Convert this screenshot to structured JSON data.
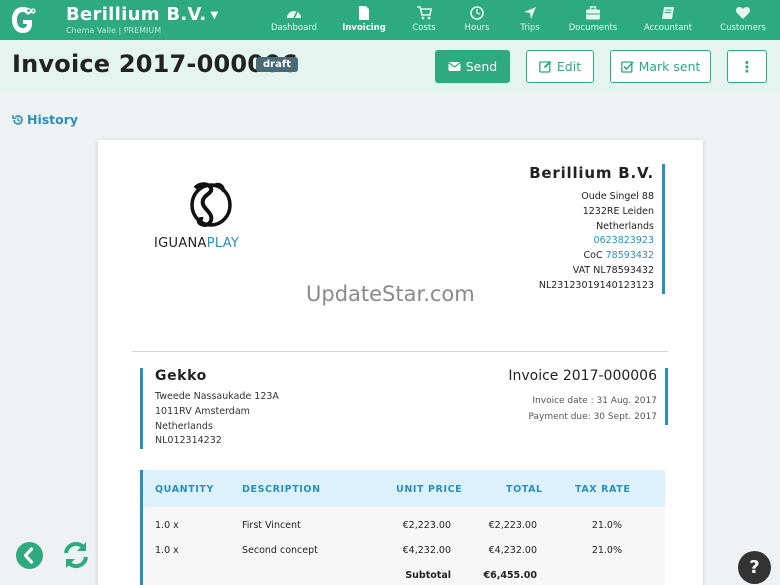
{
  "app": {
    "company_name": "Berillium B.V.",
    "user_line": "Chema Valle | PREMIUM",
    "brand_color": "#2eaa80"
  },
  "nav": [
    {
      "label": "Dashboard",
      "icon": "dashboard-icon"
    },
    {
      "label": "Invoicing",
      "icon": "file-icon",
      "active": true
    },
    {
      "label": "Costs",
      "icon": "cart-icon"
    },
    {
      "label": "Hours",
      "icon": "clock-icon"
    },
    {
      "label": "Trips",
      "icon": "location-arrow-icon"
    },
    {
      "label": "Documents",
      "icon": "briefcase-icon"
    },
    {
      "label": "Accountant",
      "icon": "book-icon"
    },
    {
      "label": "Customers",
      "icon": "heart-icon"
    }
  ],
  "header": {
    "title": "Invoice 2017-000006",
    "status": "draft",
    "send_label": "Send",
    "edit_label": "Edit",
    "mark_sent_label": "Mark sent",
    "more_label": "⋮"
  },
  "history_label": "History",
  "invoice": {
    "logo_text_a": "IGUANA",
    "logo_text_b": "PLAY",
    "sender": {
      "name": "Berillium B.V.",
      "address1": "Oude Singel 88",
      "address2": "1232RE Leiden",
      "country": "Netherlands",
      "phone": "0623823923",
      "coc_label": "CoC",
      "coc_value": "78593432",
      "vat": "VAT NL78593432",
      "iban": "NL23123019140123123"
    },
    "watermark": "UpdateStar.com",
    "client": {
      "name": "Gekko",
      "address1": "Tweede Nassaukade 123A",
      "address2": "1011RV Amsterdam",
      "country": "Netherlands",
      "vat": "NL012314232"
    },
    "number": "Invoice 2017-000006",
    "date_line": "Invoice date : 31 Aug. 2017",
    "due_line": "Payment due: 30 Sept. 2017",
    "table": {
      "headers": [
        "QUANTITY",
        "DESCRIPTION",
        "UNIT PRICE",
        "TOTAL",
        "TAX RATE"
      ],
      "rows": [
        {
          "qty": "1.0 x",
          "desc": "First Vincent",
          "unit": "€2,223.00",
          "total": "€2,223.00",
          "tax": "21.0%"
        },
        {
          "qty": "1.0 x",
          "desc": "Second concept",
          "unit": "€4,232.00",
          "total": "€4,232.00",
          "tax": "21.0%"
        }
      ],
      "subtotal_label": "Subtotal",
      "subtotal_value": "€6,455.00"
    }
  },
  "help_label": "?"
}
